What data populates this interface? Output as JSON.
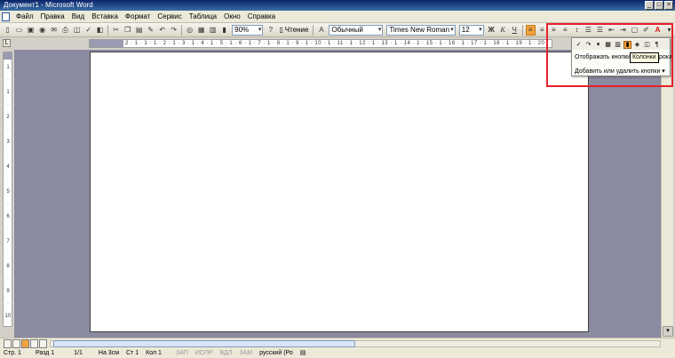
{
  "window": {
    "title": "Документ1 - Microsoft Word",
    "controls": [
      "_",
      "□",
      "×"
    ]
  },
  "menu": [
    {
      "label": "Файл",
      "accel": "Ф"
    },
    {
      "label": "Правка",
      "accel": "П"
    },
    {
      "label": "Вид",
      "accel": "В"
    },
    {
      "label": "Вставка",
      "accel": "с"
    },
    {
      "label": "Формат",
      "accel": "о"
    },
    {
      "label": "Сервис",
      "accel": "е"
    },
    {
      "label": "Таблица",
      "accel": "Т"
    },
    {
      "label": "Окно",
      "accel": "О"
    },
    {
      "label": "Справка",
      "accel": "С"
    }
  ],
  "toolbar": {
    "zoom": "90%",
    "read_label": "Чтение",
    "style": "Обычный",
    "font": "Times New Roman",
    "size": "12",
    "bold": "Ж",
    "italic": "К",
    "underline": "Ч"
  },
  "ruler": {
    "corner": "L",
    "ticks": "2 · 1 · 1 · 1 · 2 · 1 · 3 · 1 · 4 · 1 · 5 · 1 · 6 · 1 · 7 · 1 · 8 · 1 · 9 · 1 · 10 · 1 · 11 · 1 · 12 · 1 · 13 · 1 · 14 · 1 · 15 · 1 · 16 · 1 · 17 · 1 · 18 · 1 · 19 · 1 · 20 · 1 · 21 · 1 · 22 · 1 · 23 · 1 · 24 · 1 · 25 · 1 · 26",
    "vticks": [
      "1",
      "·",
      "1",
      "·",
      "2",
      "·",
      "3",
      "·",
      "4",
      "·",
      "5",
      "·",
      "6",
      "·",
      "7",
      "·",
      "8",
      "·",
      "9",
      "·",
      "10",
      "·"
    ]
  },
  "options_panel": {
    "show_buttons": "Отображать кнопки",
    "show_buttons_accel": "ж",
    "tooltip": "Колонки",
    "truncated": "рока",
    "add_remove": "Добавить или удалить кнопки",
    "add_remove_accel": "Д"
  },
  "statusbar": {
    "page": "Стр. 1",
    "section": "Разд 1",
    "pages": "1/1",
    "position": "На 3см",
    "line": "Ст 1",
    "column": "Кол 1",
    "rec": "ЗАП",
    "trk": "ИСПР",
    "ext": "ВДЛ",
    "ovr": "ЗАМ",
    "language": "русский (Ро"
  },
  "colors": {
    "highlight": "#e8202a",
    "active_button": "#f3a23a",
    "title_bar": "#0a246a"
  }
}
